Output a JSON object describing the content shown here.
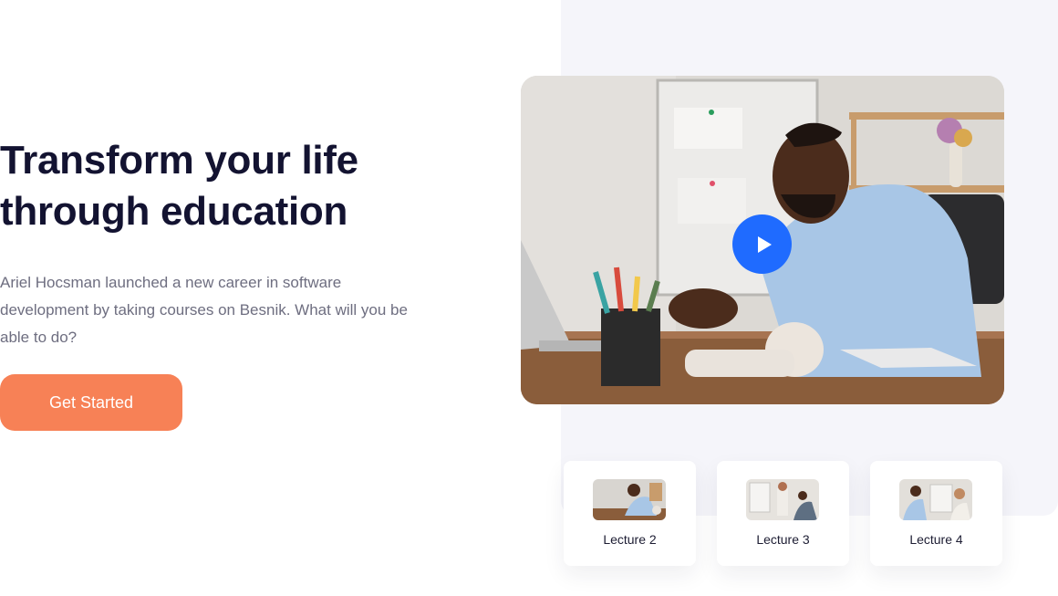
{
  "hero": {
    "title_line1": "Transform your life",
    "title_line2": "through education",
    "description": "Ariel Hocsman launched a new career in software development by taking courses on Besnik. What will you be able to do?",
    "cta_label": "Get Started"
  },
  "video": {
    "play_icon": "play-icon"
  },
  "lectures": [
    {
      "label": "Lecture 2"
    },
    {
      "label": "Lecture 3"
    },
    {
      "label": "Lecture 4"
    }
  ],
  "colors": {
    "heading": "#131331",
    "body_text": "#6e6e80",
    "cta_bg": "#f78156",
    "play_bg": "#1f6bff",
    "panel_bg": "#f5f5fa"
  }
}
